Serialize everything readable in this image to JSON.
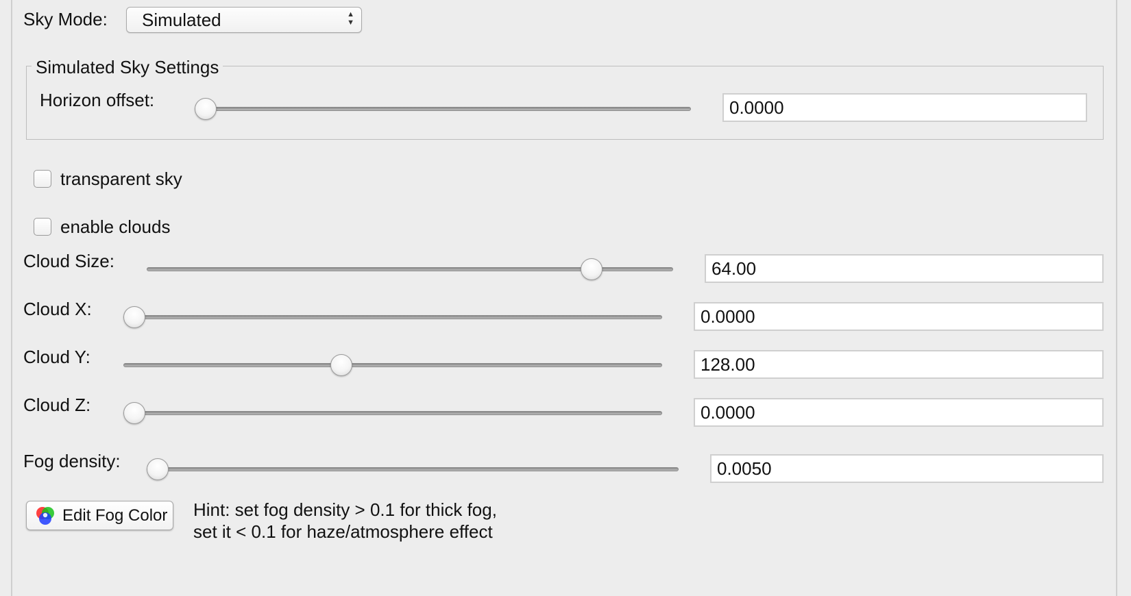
{
  "sky_mode": {
    "label": "Sky Mode:",
    "selected": "Simulated"
  },
  "simulated_settings": {
    "title": "Simulated Sky Settings",
    "horizon_offset": {
      "label": "Horizon offset:",
      "value": "0.0000",
      "level": 0.0
    }
  },
  "checkboxes": {
    "transparent_sky": {
      "label": "transparent sky",
      "checked": false
    },
    "enable_clouds": {
      "label": "enable clouds",
      "checked": false
    }
  },
  "clouds": {
    "size": {
      "label": "Cloud Size:",
      "value": "64.00",
      "level": 0.86
    },
    "x": {
      "label": "Cloud X:",
      "value": "0.0000",
      "level": 0.0
    },
    "y": {
      "label": "Cloud Y:",
      "value": "128.00",
      "level": 0.4
    },
    "z": {
      "label": "Cloud Z:",
      "value": "0.0000",
      "level": 0.0
    }
  },
  "fog": {
    "density_label": "Fog density:",
    "density_value": "0.0050",
    "density_level": 0.0,
    "edit_color_label": "Edit Fog Color",
    "hint_line1": "Hint: set fog density > 0.1 for thick fog,",
    "hint_line2": "set it < 0.1 for haze/atmosphere effect"
  }
}
